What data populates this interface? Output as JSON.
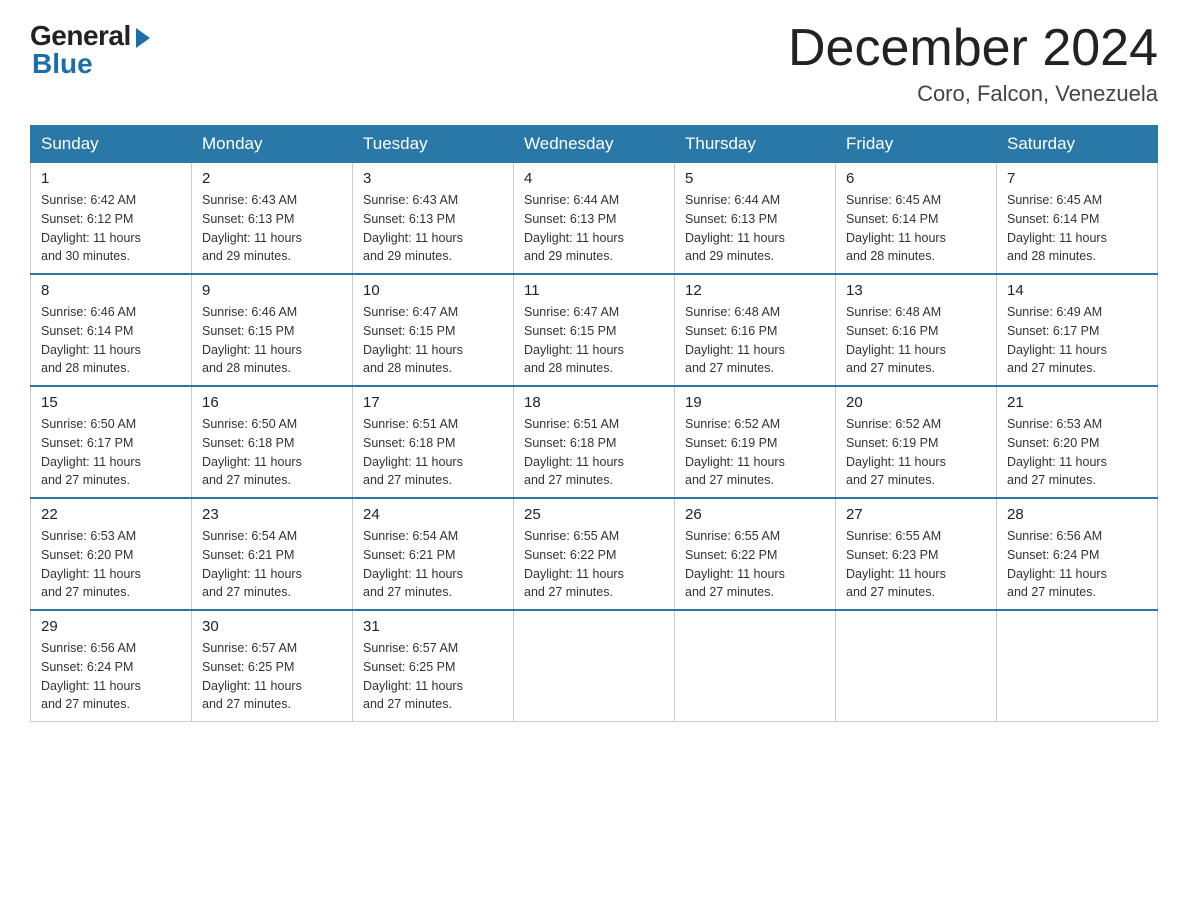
{
  "header": {
    "logo_general": "General",
    "logo_blue": "Blue",
    "month_title": "December 2024",
    "location": "Coro, Falcon, Venezuela"
  },
  "days_of_week": [
    "Sunday",
    "Monday",
    "Tuesday",
    "Wednesday",
    "Thursday",
    "Friday",
    "Saturday"
  ],
  "weeks": [
    [
      {
        "day": "1",
        "sunrise": "6:42 AM",
        "sunset": "6:12 PM",
        "daylight": "11 hours and 30 minutes."
      },
      {
        "day": "2",
        "sunrise": "6:43 AM",
        "sunset": "6:13 PM",
        "daylight": "11 hours and 29 minutes."
      },
      {
        "day": "3",
        "sunrise": "6:43 AM",
        "sunset": "6:13 PM",
        "daylight": "11 hours and 29 minutes."
      },
      {
        "day": "4",
        "sunrise": "6:44 AM",
        "sunset": "6:13 PM",
        "daylight": "11 hours and 29 minutes."
      },
      {
        "day": "5",
        "sunrise": "6:44 AM",
        "sunset": "6:13 PM",
        "daylight": "11 hours and 29 minutes."
      },
      {
        "day": "6",
        "sunrise": "6:45 AM",
        "sunset": "6:14 PM",
        "daylight": "11 hours and 28 minutes."
      },
      {
        "day": "7",
        "sunrise": "6:45 AM",
        "sunset": "6:14 PM",
        "daylight": "11 hours and 28 minutes."
      }
    ],
    [
      {
        "day": "8",
        "sunrise": "6:46 AM",
        "sunset": "6:14 PM",
        "daylight": "11 hours and 28 minutes."
      },
      {
        "day": "9",
        "sunrise": "6:46 AM",
        "sunset": "6:15 PM",
        "daylight": "11 hours and 28 minutes."
      },
      {
        "day": "10",
        "sunrise": "6:47 AM",
        "sunset": "6:15 PM",
        "daylight": "11 hours and 28 minutes."
      },
      {
        "day": "11",
        "sunrise": "6:47 AM",
        "sunset": "6:15 PM",
        "daylight": "11 hours and 28 minutes."
      },
      {
        "day": "12",
        "sunrise": "6:48 AM",
        "sunset": "6:16 PM",
        "daylight": "11 hours and 27 minutes."
      },
      {
        "day": "13",
        "sunrise": "6:48 AM",
        "sunset": "6:16 PM",
        "daylight": "11 hours and 27 minutes."
      },
      {
        "day": "14",
        "sunrise": "6:49 AM",
        "sunset": "6:17 PM",
        "daylight": "11 hours and 27 minutes."
      }
    ],
    [
      {
        "day": "15",
        "sunrise": "6:50 AM",
        "sunset": "6:17 PM",
        "daylight": "11 hours and 27 minutes."
      },
      {
        "day": "16",
        "sunrise": "6:50 AM",
        "sunset": "6:18 PM",
        "daylight": "11 hours and 27 minutes."
      },
      {
        "day": "17",
        "sunrise": "6:51 AM",
        "sunset": "6:18 PM",
        "daylight": "11 hours and 27 minutes."
      },
      {
        "day": "18",
        "sunrise": "6:51 AM",
        "sunset": "6:18 PM",
        "daylight": "11 hours and 27 minutes."
      },
      {
        "day": "19",
        "sunrise": "6:52 AM",
        "sunset": "6:19 PM",
        "daylight": "11 hours and 27 minutes."
      },
      {
        "day": "20",
        "sunrise": "6:52 AM",
        "sunset": "6:19 PM",
        "daylight": "11 hours and 27 minutes."
      },
      {
        "day": "21",
        "sunrise": "6:53 AM",
        "sunset": "6:20 PM",
        "daylight": "11 hours and 27 minutes."
      }
    ],
    [
      {
        "day": "22",
        "sunrise": "6:53 AM",
        "sunset": "6:20 PM",
        "daylight": "11 hours and 27 minutes."
      },
      {
        "day": "23",
        "sunrise": "6:54 AM",
        "sunset": "6:21 PM",
        "daylight": "11 hours and 27 minutes."
      },
      {
        "day": "24",
        "sunrise": "6:54 AM",
        "sunset": "6:21 PM",
        "daylight": "11 hours and 27 minutes."
      },
      {
        "day": "25",
        "sunrise": "6:55 AM",
        "sunset": "6:22 PM",
        "daylight": "11 hours and 27 minutes."
      },
      {
        "day": "26",
        "sunrise": "6:55 AM",
        "sunset": "6:22 PM",
        "daylight": "11 hours and 27 minutes."
      },
      {
        "day": "27",
        "sunrise": "6:55 AM",
        "sunset": "6:23 PM",
        "daylight": "11 hours and 27 minutes."
      },
      {
        "day": "28",
        "sunrise": "6:56 AM",
        "sunset": "6:24 PM",
        "daylight": "11 hours and 27 minutes."
      }
    ],
    [
      {
        "day": "29",
        "sunrise": "6:56 AM",
        "sunset": "6:24 PM",
        "daylight": "11 hours and 27 minutes."
      },
      {
        "day": "30",
        "sunrise": "6:57 AM",
        "sunset": "6:25 PM",
        "daylight": "11 hours and 27 minutes."
      },
      {
        "day": "31",
        "sunrise": "6:57 AM",
        "sunset": "6:25 PM",
        "daylight": "11 hours and 27 minutes."
      },
      null,
      null,
      null,
      null
    ]
  ],
  "labels": {
    "sunrise": "Sunrise:",
    "sunset": "Sunset:",
    "daylight": "Daylight:"
  }
}
